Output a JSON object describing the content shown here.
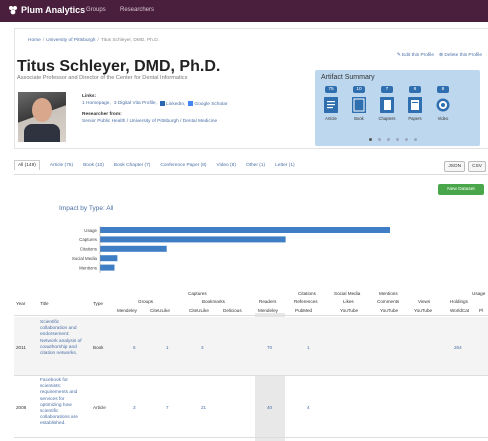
{
  "app": {
    "logo_text": "Plum Analytics",
    "nav": [
      "Groups",
      "Researchers"
    ]
  },
  "breadcrumb": [
    "Home",
    "University of Pittsburgh",
    "Titus Schleyer, DMD, Ph.D."
  ],
  "profile": {
    "name": "Titus Schleyer, DMD, Ph.D.",
    "subtitle": "Associate Professor and Director of the Center for Dental Informatics",
    "edit_link": "Edit this Profile",
    "delete_link": "Delete this Profile",
    "links_label": "Links:",
    "links": [
      "1 Homepage,",
      "3 Digital Vita Profile,",
      "LinkedIn,",
      "Google Scholar"
    ],
    "researcher_label": "Researcher from:",
    "researcher_from": "Senior Public Health / University of Pittsburgh / Dental Medicine"
  },
  "artifact_summary": {
    "title": "Artifact Summary",
    "items": [
      {
        "count": "75",
        "label": "Article",
        "icon": "article-icon"
      },
      {
        "count": "10",
        "label": "Book",
        "icon": "book-icon"
      },
      {
        "count": "7",
        "label": "Chapters",
        "icon": "chapter-icon"
      },
      {
        "count": "8",
        "label": "Papers",
        "icon": "paper-icon"
      },
      {
        "count": "8",
        "label": "Video",
        "icon": "video-icon"
      }
    ],
    "active_page": 0,
    "page_count": 6
  },
  "tabs": [
    "All (149)",
    "Article (75)",
    "Book (10)",
    "Book Chapter (7)",
    "Conference Paper (8)",
    "Video (8)",
    "Other (1)",
    "Letter (1)"
  ],
  "format_buttons": [
    "JSON",
    "CSV"
  ],
  "new_dataset_label": "New Dataset",
  "impact_by_type": {
    "label": "Impact by Type:",
    "value": "All"
  },
  "chart_data": {
    "type": "bar",
    "orientation": "horizontal",
    "categories": [
      "Usage",
      "Captures",
      "Citations",
      "Social Media",
      "Mentions"
    ],
    "values": [
      100,
      64,
      23,
      6,
      5
    ],
    "xlim": [
      0,
      100
    ],
    "color": "#3f7ec5",
    "grid": false
  },
  "table": {
    "group_headers": [
      "Captures",
      "Citations",
      "Social Media",
      "Mentions",
      "Usage"
    ],
    "sub_headers": [
      "Groups",
      "Bookmarks",
      "Readers",
      "References",
      "Likes",
      "Comments",
      "Views",
      "Holdings"
    ],
    "columns": [
      "Year",
      "Title",
      "Type",
      "Mendeley",
      "CiteULike",
      "CiteULike",
      "Delicious",
      "Mendeley",
      "PubMed",
      "YouTube",
      "YouTube",
      "YouTube",
      "WorldCat",
      "Pl"
    ],
    "rows": [
      {
        "year": "2011",
        "title": "Scientific collaboration and endorsement: Network analysis of coauthorship and citation networks.",
        "type": "Book",
        "values": [
          "6",
          "1",
          "3",
          "",
          "70",
          "1",
          "",
          "",
          "",
          "264"
        ]
      },
      {
        "year": "2008",
        "title": "Facebook for scientists: requirements and services for optimizing how scientific collaborations are established.",
        "type": "Article",
        "values": [
          "3",
          "7",
          "21",
          "",
          "40",
          "4",
          "",
          "",
          "",
          ""
        ]
      }
    ]
  },
  "colors": {
    "topbar": "#4a1f3d",
    "accent": "#4a6fa5",
    "artifact_bg": "#bcd7ee",
    "bar": "#3f7ec5",
    "new_dataset": "#4aa64a"
  }
}
